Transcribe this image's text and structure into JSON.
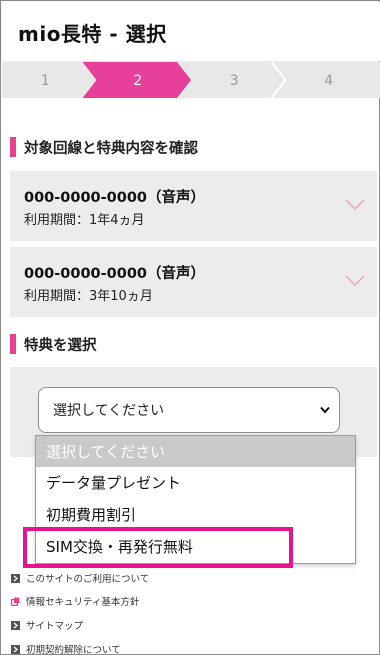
{
  "app": {
    "title": "mio長特 - 選択"
  },
  "steps": {
    "items": [
      {
        "label": "1",
        "active": false
      },
      {
        "label": "2",
        "active": true
      },
      {
        "label": "3",
        "active": false
      },
      {
        "label": "4",
        "active": false
      }
    ],
    "colors": {
      "inactive_bg": "#e8e8e8",
      "active_bg": "#e6409a",
      "inactive_text": "#9a9a9a",
      "active_text": "#ffffff"
    }
  },
  "confirm_section": {
    "heading": "対象回線と特典内容を確認",
    "lines": [
      {
        "number": "000-0000-0000（音声）",
        "period": "利用期間：1年4ヵ月",
        "icon": "chevron-down-icon"
      },
      {
        "number": "000-0000-0000（音声）",
        "period": "利用期間：3年10ヵ月",
        "icon": "chevron-down-icon"
      }
    ]
  },
  "benefit_section": {
    "heading": "特典を選択",
    "select": {
      "value": "選択してください",
      "options": [
        "選択してください",
        "データ量プレゼント",
        "初期費用割引",
        "SIM交換・再発行無料"
      ],
      "highlighted_option": "SIM交換・再発行無料"
    }
  },
  "footer": {
    "links": [
      {
        "label": "このサイトのご利用について",
        "icon": "arrow-right-icon"
      },
      {
        "label": "情報セキュリティ基本方針",
        "icon": "external-link-icon"
      },
      {
        "label": "サイトマップ",
        "icon": "arrow-right-icon"
      },
      {
        "label": "初期契約解除について",
        "icon": "arrow-right-icon"
      }
    ]
  },
  "colors": {
    "accent": "#e6408e",
    "highlight": "#e5138e",
    "card_bg": "#ececec"
  }
}
